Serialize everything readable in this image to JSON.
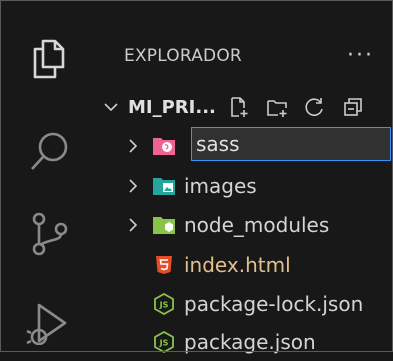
{
  "sidebar": {
    "title": "EXPLORADOR",
    "more_label": "···"
  },
  "folder": {
    "name": "MI_PRI..."
  },
  "rename": {
    "value": "sass"
  },
  "tree": {
    "items": [
      {
        "label": "sass",
        "kind": "folder",
        "color": "#f06292"
      },
      {
        "label": "images",
        "kind": "folder",
        "color": "#26a69a"
      },
      {
        "label": "node_modules",
        "kind": "folder",
        "color": "#8bc34a"
      },
      {
        "label": "index.html",
        "kind": "html",
        "color": "#e44d26",
        "text_color": "#e2c08d"
      },
      {
        "label": "package-lock.json",
        "kind": "js",
        "color": "#8bc34a"
      },
      {
        "label": "package.json",
        "kind": "js",
        "color": "#8bc34a"
      }
    ]
  },
  "icons": {
    "explorer": "files-icon",
    "search": "search-icon",
    "source_control": "source-control-icon",
    "run_debug": "run-debug-icon"
  }
}
